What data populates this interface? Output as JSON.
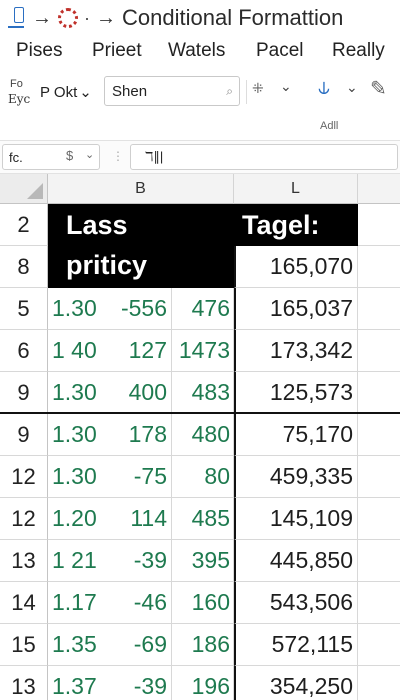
{
  "titlebar": {
    "arrow": "→",
    "dot": "·",
    "title": "Conditional Formattion"
  },
  "menu": [
    "Pises",
    "Prieet",
    "Watels",
    "Pacel",
    "Really"
  ],
  "ribbon": {
    "format_top": "Fo",
    "format_bot": "Eyc",
    "font_name": "P Okt",
    "font_size_value": "Shen",
    "group_label": "Adll"
  },
  "formula": {
    "name_box": "fc.",
    "content": "ℸ∥|"
  },
  "sheet": {
    "columns": {
      "b": "B",
      "l": "L"
    },
    "header": {
      "left_line1": "Lass",
      "left_line2": "priticy",
      "right": "Tagel:",
      "first_value": "165,070"
    },
    "row_numbers": [
      "2",
      "8",
      "5",
      "6",
      "9",
      "9",
      "12",
      "12",
      "13",
      "14",
      "15",
      "13"
    ],
    "rows": [
      {
        "b1": "1.30",
        "b2": "-556",
        "c": "476",
        "l": "165,037"
      },
      {
        "b1": "1 40",
        "b2": "127",
        "c": "1473",
        "l": "173,342"
      },
      {
        "b1": "1.30",
        "b2": "400",
        "c": "483",
        "l": "125,573"
      },
      {
        "b1": "1.30",
        "b2": "178",
        "c": "480",
        "l": "75,170"
      },
      {
        "b1": "1.30",
        "b2": "-75",
        "c": "80",
        "l": "459,335"
      },
      {
        "b1": "1.20",
        "b2": "114",
        "c": "485",
        "l": "145,109"
      },
      {
        "b1": "1 21",
        "b2": "-39",
        "c": "395",
        "l": "445,850"
      },
      {
        "b1": "1.17",
        "b2": "-46",
        "c": "160",
        "l": "543,506"
      },
      {
        "b1": "1.35",
        "b2": "-69",
        "c": "186",
        "l": "572,115"
      },
      {
        "b1": "1.37",
        "b2": "-39",
        "c": "196",
        "l": "354,250"
      }
    ]
  },
  "colors": {
    "green_text": "#1e7a4f",
    "header_bg": "#000000",
    "accent": "#2b6fc2"
  }
}
